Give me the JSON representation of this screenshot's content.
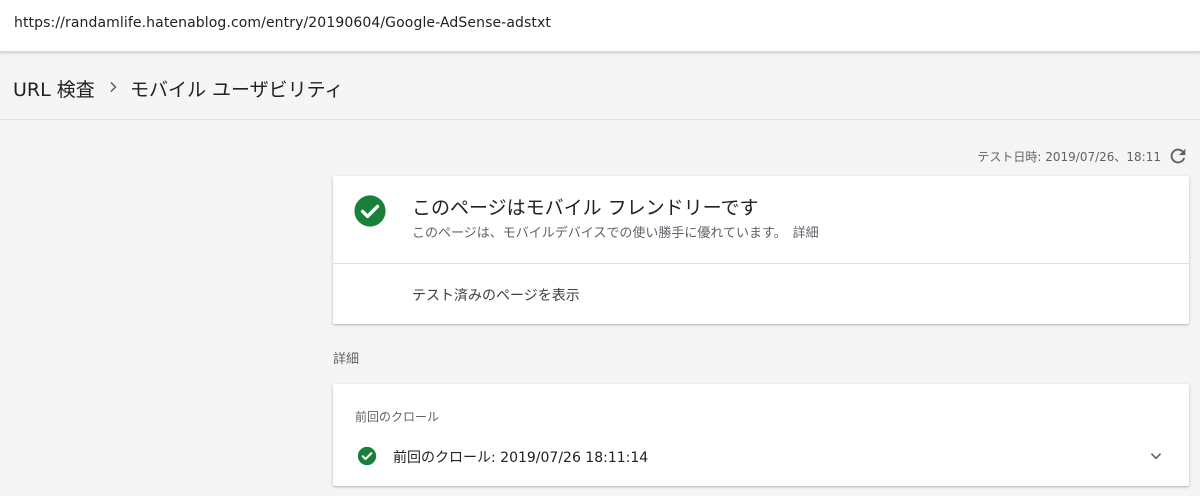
{
  "address_bar": {
    "url": "https://randamlife.hatenablog.com/entry/20190604/Google-AdSense-adstxt"
  },
  "breadcrumb": {
    "parent": "URL 検査",
    "current": "モバイル ユーザビリティ"
  },
  "test_info": {
    "date_text": "テスト日時: 2019/07/26、18:11"
  },
  "result_card": {
    "title": "このページはモバイル フレンドリーです",
    "subtitle": "このページは、モバイルデバイスでの使い勝手に優れています。",
    "details_link": "詳細",
    "view_tested_page": "テスト済みのページを表示"
  },
  "details": {
    "section_title": "詳細",
    "crawl_label": "前回のクロール",
    "crawl_value": "前回のクロール: 2019/07/26 18:11:14"
  },
  "icons": {
    "success": "check-circle-icon",
    "refresh": "refresh-icon",
    "breadcrumb_separator": "chevron-right-icon",
    "expand": "chevron-down-icon"
  },
  "colors": {
    "success_green": "#188038",
    "icon_gray": "#5f6368"
  }
}
